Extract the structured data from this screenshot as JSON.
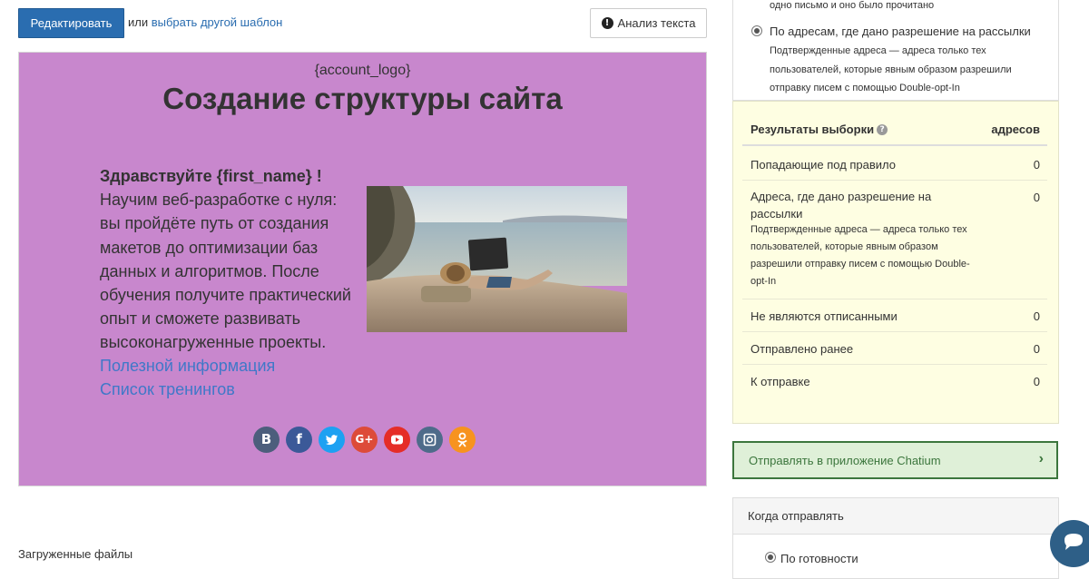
{
  "toolbar": {
    "edit_label": "Редактировать",
    "or_text": "или",
    "template_link": "выбрать другой шаблон",
    "analyze_label": "Анализ текста"
  },
  "email": {
    "logo_placeholder": "{account_logo}",
    "title": "Создание структуры сайта",
    "greeting": "Здравствуйте {first_name} !",
    "body_lines": [
      "Научим веб-разработке с нуля:",
      "вы пройдёте путь от создания",
      "макетов до оптимизации баз",
      "данных и алгоритмов. После",
      "обучения получите практический",
      "опыт и сможете развивать",
      "высоконагруженные проекты."
    ],
    "links": [
      "Полезной информация",
      "Список тренингов"
    ],
    "socials": [
      {
        "icon": "vk-icon",
        "glyph": "B",
        "color": "#4c5e7c"
      },
      {
        "icon": "facebook-icon",
        "glyph": "f",
        "color": "#3b5998"
      },
      {
        "icon": "twitter-icon",
        "glyph": "t",
        "color": "#1da1f2"
      },
      {
        "icon": "google-plus-icon",
        "glyph": "G+",
        "color": "#dd4b39"
      },
      {
        "icon": "youtube-icon",
        "glyph": "▶",
        "color": "#e52d27"
      },
      {
        "icon": "instagram-icon",
        "glyph": "◉",
        "color": "#4e6b8a"
      },
      {
        "icon": "odnoklassniki-icon",
        "glyph": "ok",
        "color": "#f7931e"
      }
    ]
  },
  "uploaded_files_label": "Загруженные файлы",
  "options": {
    "prev_text": "одно письмо и оно было прочитано",
    "selected_label": "По адресам, где дано разрешение на рассылки",
    "selected_desc": "Подтвержденные адреса — адреса только тех пользователей, которые явным образом разрешили отправку писем с помощью Double-opt-In"
  },
  "results": {
    "header_label": "Результаты выборки",
    "header_col": "адресов",
    "rows": [
      {
        "label": "Попадающие под правило",
        "value": "0"
      },
      {
        "label": "Адреса, где дано разрешение на рассылки",
        "value": "0",
        "sub": "Подтвержденные адреса — адреса только тех пользователей, которые явным образом разрешили отправку писем с помощью Double-opt-In"
      },
      {
        "label": "Не являются отписанными",
        "value": "0"
      },
      {
        "label": "Отправлено ранее",
        "value": "0"
      },
      {
        "label": "К отправке",
        "value": "0"
      }
    ]
  },
  "chatium": {
    "label": "Отправлять в приложение Chatium",
    "chevron": "›"
  },
  "when": {
    "header": "Когда отправлять",
    "option": "По готовности"
  }
}
